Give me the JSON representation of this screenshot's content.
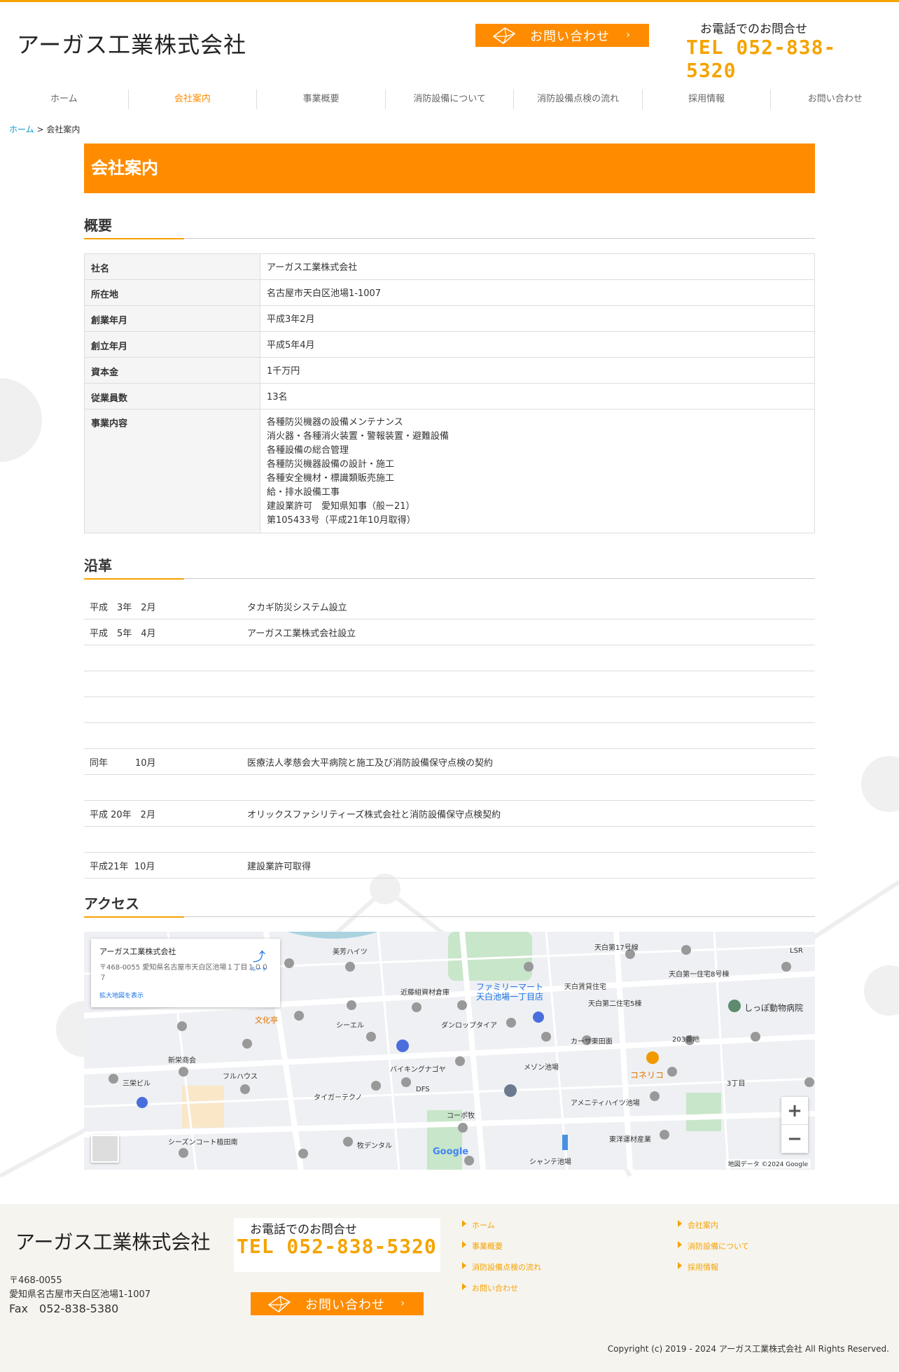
{
  "company": "アーガス工業株式会社",
  "header": {
    "contact_label": "お問い合わせ",
    "tel_caption": "お電話でのお問合せ",
    "tel_number": "TEL 052-838-5320"
  },
  "nav": [
    "ホーム",
    "会社案内",
    "事業概要",
    "消防設備について",
    "消防設備点検の流れ",
    "採用情報",
    "お問い合わせ"
  ],
  "breadcrumb": {
    "home": "ホーム",
    "sep": " > ",
    "current": "会社案内"
  },
  "page_title": "会社案内",
  "overview": {
    "title": "概要",
    "rows": [
      {
        "k": "社名",
        "v": [
          "アーガス工業株式会社"
        ]
      },
      {
        "k": "所在地",
        "v": [
          "名古屋市天白区池場1-1007"
        ]
      },
      {
        "k": "創業年月",
        "v": [
          "平成3年2月"
        ]
      },
      {
        "k": "創立年月",
        "v": [
          "平成5年4月"
        ]
      },
      {
        "k": "資本金",
        "v": [
          "1千万円"
        ]
      },
      {
        "k": "従業員数",
        "v": [
          "13名"
        ]
      },
      {
        "k": "事業内容",
        "v": [
          "各種防災機器の設備メンテナンス",
          "消火器・各種消火装置・警報装置・避難設備",
          "各種設備の総合管理",
          "各種防災機器設備の設計・施工",
          "各種安全機材・標識類販売施工",
          "給・排水設備工事",
          "建設業許可　愛知県知事（般ー21）",
          "第105433号（平成21年10月取得）"
        ]
      }
    ]
  },
  "history": {
    "title": "沿革",
    "rows": [
      {
        "d": "平成　3年　2月",
        "e": "タカギ防災システム設立"
      },
      {
        "d": "平成　5年　4月",
        "e": "アーガス工業株式会社設立"
      },
      {
        "d": "",
        "e": ""
      },
      {
        "d": "",
        "e": ""
      },
      {
        "d": "",
        "e": ""
      },
      {
        "d": "",
        "e": ""
      },
      {
        "d": "同年　　　10月",
        "e": "医療法人孝慈会大平病院と施工及び消防設備保守点検の契約"
      },
      {
        "d": "",
        "e": ""
      },
      {
        "d": "平成 20年　2月",
        "e": "オリックスファシリティーズ株式会社と消防設備保守点検契約"
      },
      {
        "d": "",
        "e": ""
      },
      {
        "d": "平成21年  10月",
        "e": "建設業許可取得"
      }
    ]
  },
  "access": {
    "title": "アクセス",
    "map_card_name": "アーガス工業株式会社",
    "map_card_addr": "〒468-0055 愛知県名古屋市天白区池場１丁目１００７",
    "map_card_link": "拡大地図を表示",
    "map_route": "ルート",
    "map_copy": "地図データ ©2024 Google",
    "map_labels": [
      "美芳ハイツ",
      "天白第17号線",
      "ファミリーマート",
      "天白池場一丁目店",
      "天白第一住宅8号棟",
      "しっぽ動物病院",
      "近藤組資材倉庫",
      "天白賃貸住宅",
      "天白第二住宅5棟",
      "文化亭",
      "シーエル",
      "ダンロップタイア",
      "カーサ東田面",
      "203番地",
      "コネリコ",
      "新栄商会",
      "フルハウス",
      "バイキングナゴヤ",
      "メゾン池場",
      "3丁目",
      "三栄ビル",
      "タイガーテクノ",
      "DFS",
      "コーポ牧",
      "アメニティハイツ池場",
      "シーズンコート植田南",
      "牧デンタル",
      "東洋運材産業",
      "シャンテ池場",
      "LSR"
    ]
  },
  "footer": {
    "zip": "〒468-0055",
    "address": "愛知県名古屋市天白区池場1-1007",
    "fax": "Fax　052-838-5380",
    "links": [
      "ホーム",
      "会社案内",
      "事業概要",
      "消防設備について",
      "消防設備点検の流れ",
      "採用情報",
      "お問い合わせ"
    ],
    "copyright": "Copyright (c) 2019 - 2024 アーガス工業株式会社 All Rights Reserved."
  },
  "colors": {
    "accent": "#ff8c00",
    "tel": "#f5a300",
    "link": "#0099cc"
  }
}
